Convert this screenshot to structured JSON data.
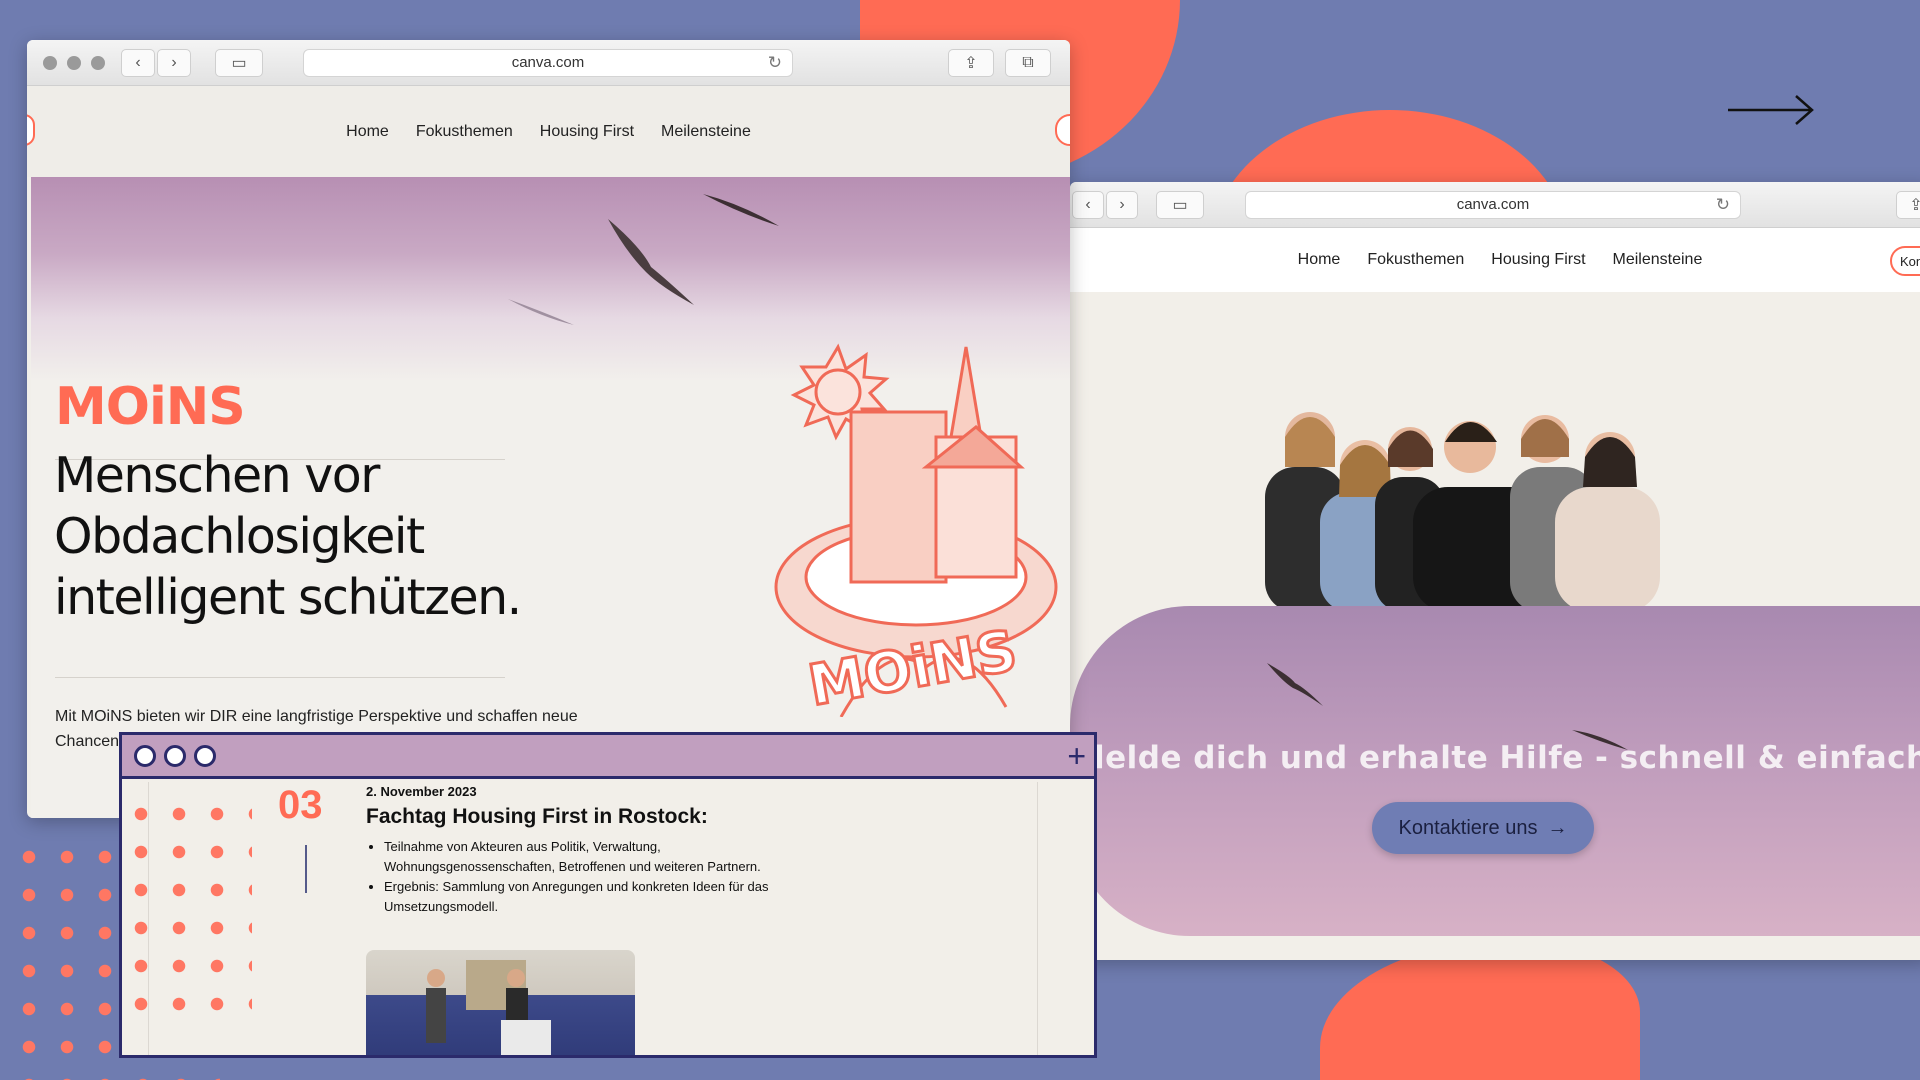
{
  "left_window": {
    "url": "canva.com",
    "nav": [
      "Home",
      "Fokusthemen",
      "Housing First",
      "Meilensteine"
    ],
    "logo": "MOiNS",
    "headline": [
      "Menschen vor",
      "Obdachlosigkeit",
      "intelligent schützen."
    ],
    "lead": "Mit MOiNS bieten wir DIR eine langfristige Perspektive und schaffen neue Chancen. Weil Wohnen ist für uns ein Menschenrecht!",
    "illustration_label": "MOiNS"
  },
  "right_window": {
    "url": "canva.com",
    "nav": [
      "Home",
      "Fokusthemen",
      "Housing First",
      "Meilensteine"
    ],
    "nav_pill": "Kon",
    "cta_text": "lelde dich und erhalte Hilfe - schnell & einfach",
    "cta_button": "Kontaktiere uns"
  },
  "timeline_card": {
    "number": "03",
    "date": "2. November 2023",
    "title": "Fachtag Housing First in Rostock:",
    "bullets": [
      "Teilnahme von Akteuren aus Politik, Verwaltung, Wohnungsgenossenschaften, Betroffenen und weiteren Partnern.",
      "Ergebnis: Sammlung von Anregungen und konkreten Ideen für das Umsetzungsmodell."
    ]
  },
  "icons": {
    "back": "chevron-left-icon",
    "forward": "chevron-right-icon",
    "sidebar": "sidebar-icon",
    "share": "share-icon",
    "tabs": "tabs-icon",
    "reload": "reload-icon",
    "arrow": "arrow-right-icon",
    "plus": "plus-icon"
  },
  "colors": {
    "accent": "#ff6b54",
    "background": "#6f7cb0",
    "navy": "#2b2a6b",
    "button": "#6f7db4"
  }
}
